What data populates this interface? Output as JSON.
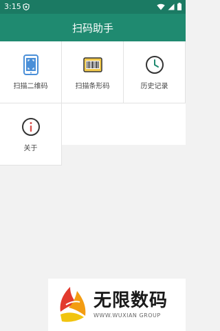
{
  "status_bar": {
    "time": "3:15",
    "icons": [
      "shield-icon",
      "wifi-icon",
      "cellular-icon",
      "battery-icon"
    ]
  },
  "app_bar": {
    "title": "扫码助手"
  },
  "menu": {
    "items": [
      {
        "label": "扫描二维码",
        "icon": "phone-qr-scan-icon"
      },
      {
        "label": "扫描条形码",
        "icon": "barcode-icon"
      },
      {
        "label": "历史记录",
        "icon": "clock-icon"
      },
      {
        "label": "关于",
        "icon": "info-icon"
      }
    ]
  },
  "watermark": {
    "title": "无限数码",
    "subtitle": "WWW.WUXIAN GROUP"
  },
  "colors": {
    "status_bar": "#1b7a63",
    "app_bar": "#1f8a70",
    "icon_blue": "#4a8fd8",
    "icon_green": "#1f8a70",
    "icon_red": "#d9534f",
    "icon_yellow": "#f2c94c"
  }
}
